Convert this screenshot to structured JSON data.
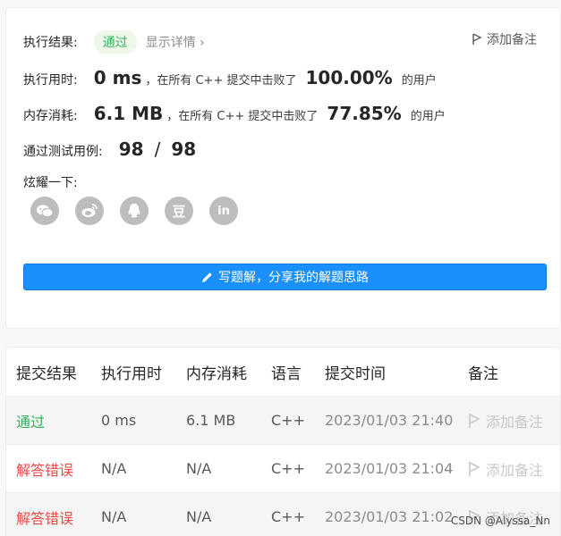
{
  "result": {
    "label": "执行结果:",
    "status": "通过",
    "detail_link": "显示详情",
    "add_note": "添加备注"
  },
  "runtime": {
    "label": "执行用时:",
    "value": "0 ms",
    "mid_text": "，在所有 C++ 提交中击败了",
    "percent": "100.00%",
    "suffix": "的用户"
  },
  "memory": {
    "label": "内存消耗:",
    "value": "6.1 MB",
    "mid_text": "，在所有 C++ 提交中击败了",
    "percent": "77.85%",
    "suffix": "的用户"
  },
  "tests": {
    "label": "通过测试用例:",
    "passed": "98",
    "sep": "/",
    "total": "98"
  },
  "share": {
    "label": "炫耀一下:",
    "items": [
      "wechat-icon",
      "weibo-icon",
      "qq-icon",
      "douban-icon",
      "linkedin-icon"
    ],
    "douban_glyph": "豆",
    "linkedin_glyph": "in"
  },
  "write_solution": "写题解，分享我的解题思路",
  "table": {
    "headers": [
      "提交结果",
      "执行用时",
      "内存消耗",
      "语言",
      "提交时间",
      "备注"
    ],
    "rows": [
      {
        "status": "通过",
        "status_type": "ok",
        "runtime": "0 ms",
        "memory": "6.1 MB",
        "lang": "C++",
        "time": "2023/01/03 21:40",
        "note": "添加备注"
      },
      {
        "status": "解答错误",
        "status_type": "err",
        "runtime": "N/A",
        "memory": "N/A",
        "lang": "C++",
        "time": "2023/01/03 21:04",
        "note": "添加备注"
      },
      {
        "status": "解答错误",
        "status_type": "err",
        "runtime": "N/A",
        "memory": "N/A",
        "lang": "C++",
        "time": "2023/01/03 21:02",
        "note": "添加备注"
      }
    ]
  },
  "watermark": "CSDN @Alyssa_Nn"
}
